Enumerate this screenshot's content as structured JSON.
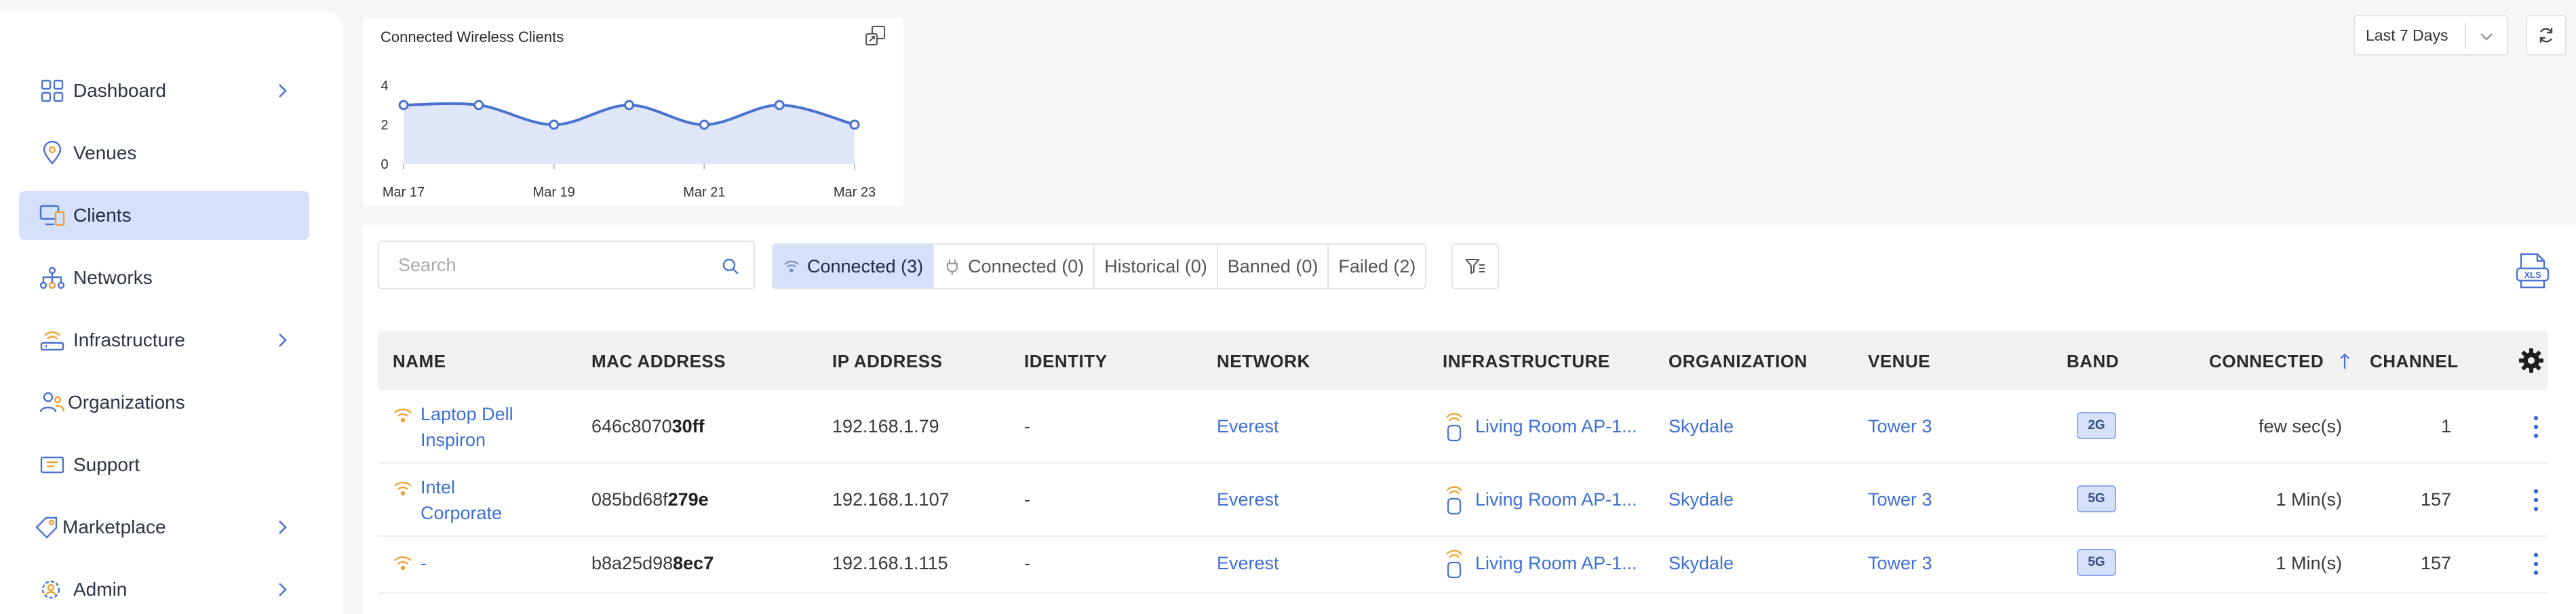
{
  "sidebar": {
    "items": [
      {
        "label": "Dashboard",
        "icon": "dashboard-grid-icon",
        "has_chevron": true
      },
      {
        "label": "Venues",
        "icon": "location-pin-icon",
        "has_chevron": false
      },
      {
        "label": "Clients",
        "icon": "clients-devices-icon",
        "has_chevron": false,
        "active": true
      },
      {
        "label": "Networks",
        "icon": "network-tree-icon",
        "has_chevron": false
      },
      {
        "label": "Infrastructure",
        "icon": "access-point-icon",
        "has_chevron": true
      },
      {
        "label": "Organizations",
        "icon": "users-group-icon",
        "has_chevron": false
      },
      {
        "label": "Support",
        "icon": "support-ticket-icon",
        "has_chevron": false
      },
      {
        "label": "Marketplace",
        "icon": "tag-icon",
        "has_chevron": true
      },
      {
        "label": "Admin",
        "icon": "admin-gear-user-icon",
        "has_chevron": true
      }
    ]
  },
  "chart": {
    "title": "Connected Wireless Clients"
  },
  "chart_data": {
    "type": "area",
    "title": "Connected Wireless Clients",
    "x": [
      "Mar 17",
      "Mar 18",
      "Mar 19",
      "Mar 20",
      "Mar 21",
      "Mar 22",
      "Mar 23"
    ],
    "x_tick_labels": [
      "Mar 17",
      "Mar 19",
      "Mar 21",
      "Mar 23"
    ],
    "series": [
      {
        "values": [
          3,
          3,
          2,
          3,
          2,
          3,
          2
        ]
      }
    ],
    "y_ticks": [
      "0",
      "2",
      "4"
    ],
    "ylim": [
      0,
      4
    ],
    "color": "#4a72d1",
    "fill_color": "#dfe6f7",
    "grid": false
  },
  "toolbar": {
    "range_label": "Last 7 Days",
    "search_placeholder": "Search",
    "tabs": [
      {
        "label": "Connected (3)",
        "icon": "wifi-icon",
        "active": true
      },
      {
        "label": "Connected (0)",
        "icon": "wired-plug-icon",
        "active": false
      },
      {
        "label": "Historical (0)",
        "active": false
      },
      {
        "label": "Banned (0)",
        "active": false
      },
      {
        "label": "Failed (2)",
        "active": false
      }
    ]
  },
  "table": {
    "headers": {
      "name": "NAME",
      "mac": "MAC ADDRESS",
      "ip": "IP ADDRESS",
      "identity": "IDENTITY",
      "network": "NETWORK",
      "infrastructure": "INFRASTRUCTURE",
      "organization": "ORGANIZATION",
      "venue": "VENUE",
      "band": "BAND",
      "connected": "CONNECTED",
      "channel": "CHANNEL"
    },
    "rows": [
      {
        "name_line1": "Laptop Dell",
        "name_line2": "Inspiron",
        "mac_prefix": "646c8070",
        "mac_suffix": "30ff",
        "ip": "192.168.1.79",
        "identity": "-",
        "network": "Everest",
        "infrastructure": "Living Room AP-1...",
        "organization": "Skydale",
        "venue": "Tower 3",
        "band": "2G",
        "connected": "few sec(s)",
        "channel": "1"
      },
      {
        "name_line1": "Intel",
        "name_line2": "Corporate",
        "mac_prefix": "085bd68f",
        "mac_suffix": "279e",
        "ip": "192.168.1.107",
        "identity": "-",
        "network": "Everest",
        "infrastructure": "Living Room AP-1...",
        "organization": "Skydale",
        "venue": "Tower 3",
        "band": "5G",
        "connected": "1 Min(s)",
        "channel": "157"
      },
      {
        "name_line1": "-",
        "name_line2": "",
        "mac_prefix": "b8a25d98",
        "mac_suffix": "8ec7",
        "ip": "192.168.1.115",
        "identity": "-",
        "network": "Everest",
        "infrastructure": "Living Room AP-1...",
        "organization": "Skydale",
        "venue": "Tower 3",
        "band": "5G",
        "connected": "1 Min(s)",
        "channel": "157"
      }
    ]
  },
  "colors": {
    "accent": "#3d6fd6",
    "active_bg": "#d5e1fb",
    "wifi_orange": "#f0a030"
  }
}
